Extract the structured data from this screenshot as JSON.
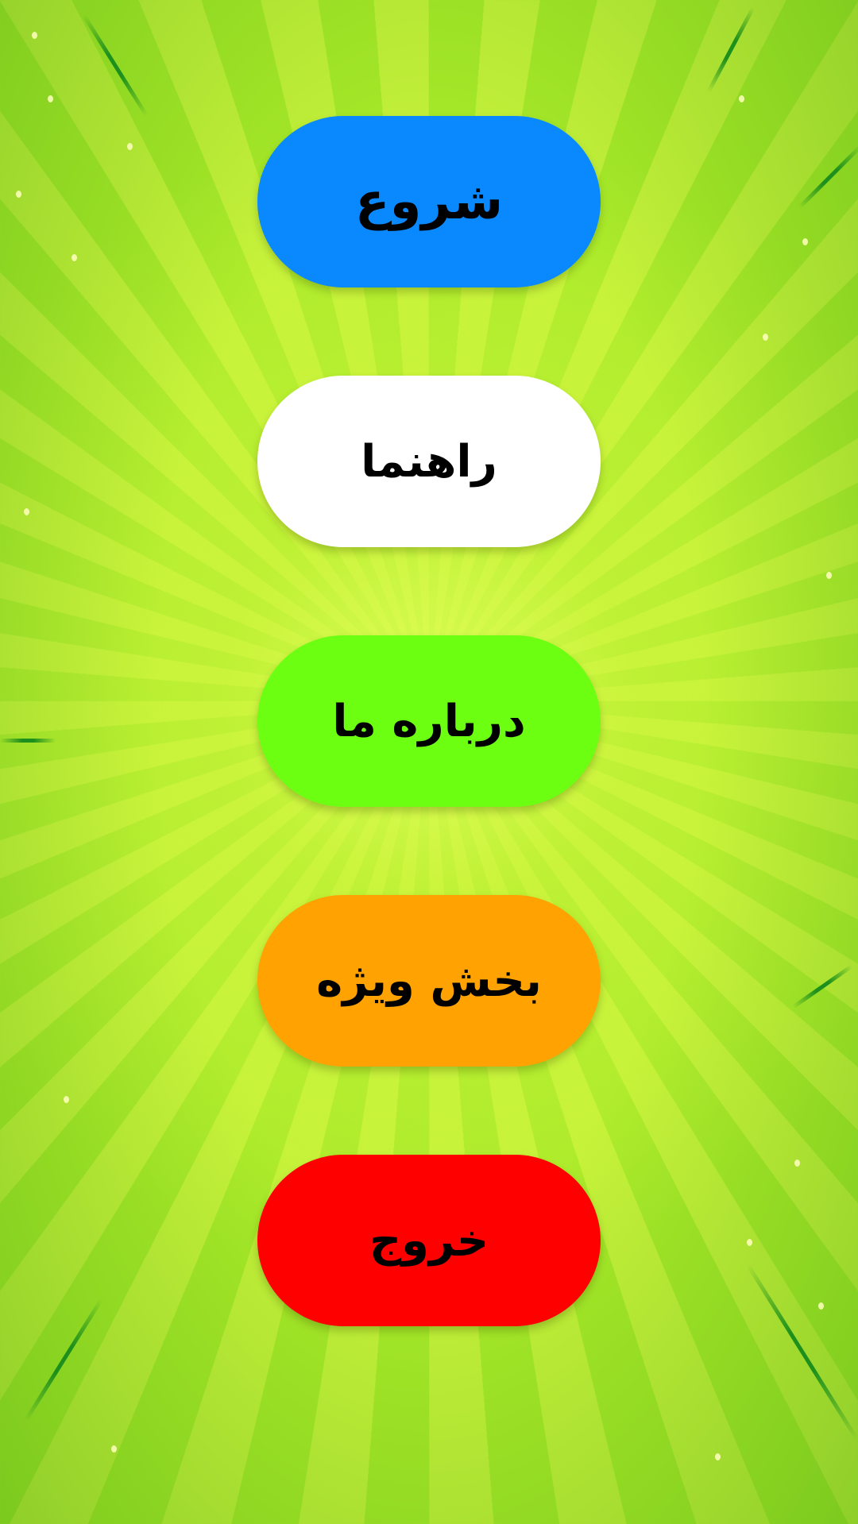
{
  "menu": {
    "buttons": [
      {
        "label": "شروع",
        "color": "#0a89ff"
      },
      {
        "label": "راهنما",
        "color": "#ffffff"
      },
      {
        "label": "درباره ما",
        "color": "#6cff12"
      },
      {
        "label": "بخش ویژه",
        "color": "#ffa202"
      },
      {
        "label": "خروج",
        "color": "#ff0000"
      }
    ]
  },
  "background": {
    "style": "green sunburst",
    "colors": [
      "#a9ea29",
      "#c6f23a",
      "#1c8f1c"
    ]
  }
}
